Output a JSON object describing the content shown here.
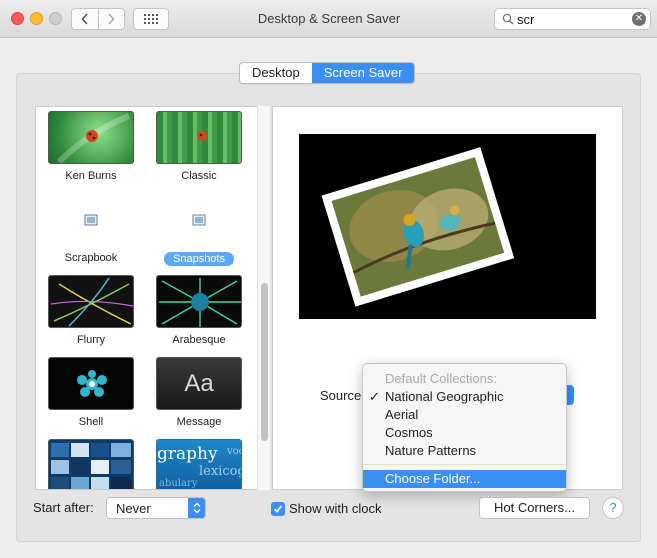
{
  "window": {
    "title": "Desktop & Screen Saver",
    "search": {
      "value": "scr",
      "clear_icon": "clear-icon"
    }
  },
  "tabs": [
    {
      "label": "Desktop",
      "active": false
    },
    {
      "label": "Screen Saver",
      "active": true
    }
  ],
  "savers": [
    {
      "label": "Ken Burns",
      "icon": "ken-burns-thumbnail"
    },
    {
      "label": "Classic",
      "icon": "classic-thumbnail"
    },
    {
      "label": "Scrapbook",
      "icon": "scrapbook-icon"
    },
    {
      "label": "Snapshots",
      "icon": "snapshots-icon",
      "selected": true
    },
    {
      "label": "Flurry",
      "icon": "flurry-thumbnail"
    },
    {
      "label": "Arabesque",
      "icon": "arabesque-thumbnail"
    },
    {
      "label": "Shell",
      "icon": "shell-thumbnail"
    },
    {
      "label": "Message",
      "icon": "message-thumbnail",
      "glyph": "Aa"
    },
    {
      "label": "",
      "icon": "album-artwork-thumbnail"
    },
    {
      "label": "",
      "icon": "word-of-the-day-thumbnail",
      "words": [
        "graphy",
        "voc",
        "lexicog",
        "abulary"
      ]
    }
  ],
  "source": {
    "label": "Source",
    "menu": {
      "header": "Default Collections:",
      "items": [
        {
          "label": "National Geographic",
          "checked": true
        },
        {
          "label": "Aerial",
          "checked": false
        },
        {
          "label": "Cosmos",
          "checked": false
        },
        {
          "label": "Nature Patterns",
          "checked": false
        }
      ],
      "choose_folder": "Choose Folder...",
      "checkmark": "✓"
    }
  },
  "bottom": {
    "start_after_label": "Start after:",
    "start_after_value": "Never",
    "show_clock_label": "Show with clock",
    "show_clock_checked": true,
    "hot_corners_label": "Hot Corners...",
    "help_label": "?"
  },
  "colors": {
    "accent": "#3b8ff2",
    "selected_pill": "#5da8f4",
    "close": "#fc5b57",
    "minimize": "#fdbc2e"
  }
}
